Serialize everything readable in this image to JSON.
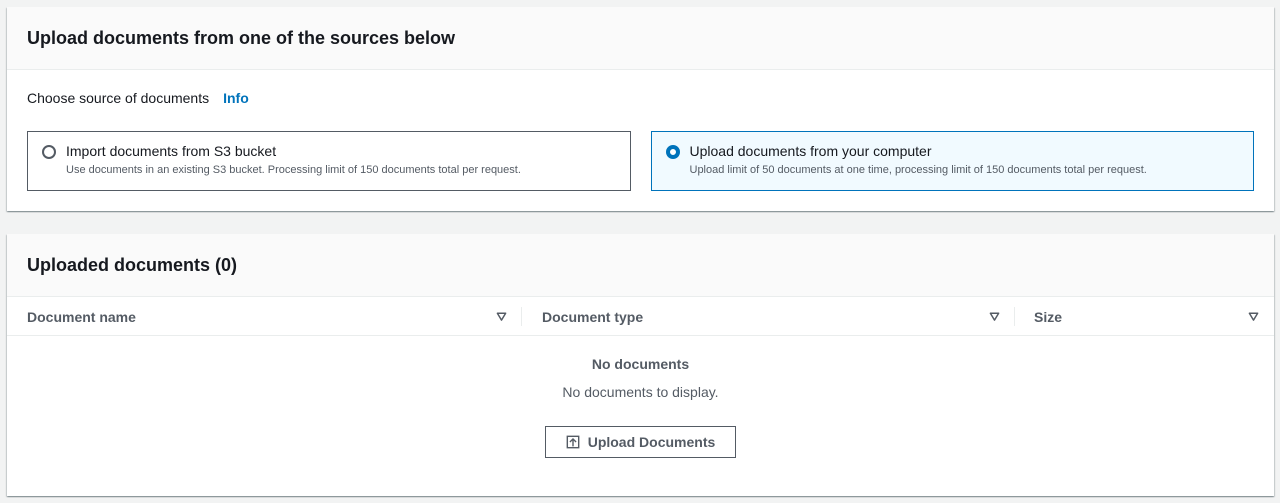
{
  "source_panel": {
    "title": "Upload documents from one of the sources below",
    "label": "Choose source of documents",
    "info_link": "Info",
    "options": [
      {
        "title": "Import documents from S3 bucket",
        "description": "Use documents in an existing S3 bucket. Processing limit of 150 documents total per request.",
        "selected": false
      },
      {
        "title": "Upload documents from your computer",
        "description": "Upload limit of 50 documents at one time, processing limit of 150 documents total per request.",
        "selected": true
      }
    ]
  },
  "documents_panel": {
    "title": "Uploaded documents (0)",
    "columns": [
      "Document name",
      "Document type",
      "Size"
    ],
    "empty_title": "No documents",
    "empty_description": "No documents to display.",
    "upload_button": "Upload Documents"
  },
  "colors": {
    "accent": "#0073bb",
    "selected_bg": "#f1faff",
    "text": "#16191f",
    "muted": "#545b64"
  },
  "icons": {
    "sort": "caret-down-icon",
    "upload": "upload-icon"
  }
}
